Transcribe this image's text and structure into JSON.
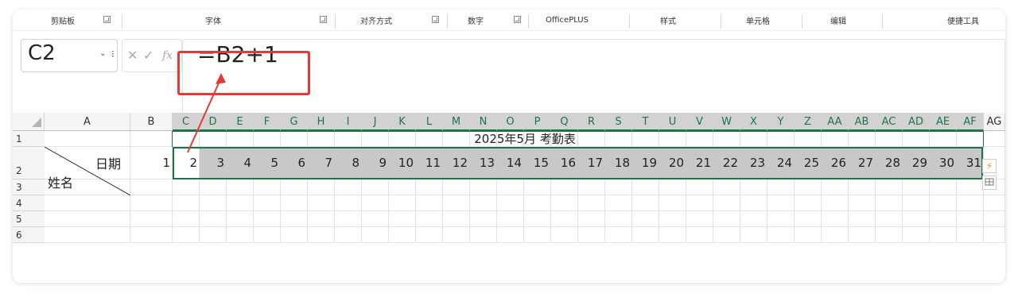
{
  "ribbon": {
    "groups": [
      "剪贴板",
      "字体",
      "对齐方式",
      "数字",
      "OfficePLUS",
      "样式",
      "单元格",
      "编辑",
      "便捷工具"
    ]
  },
  "formula_bar": {
    "name_box": "C2",
    "dropdown": "⌄",
    "dots": "⁝",
    "cancel": "✕",
    "confirm": "✓",
    "fx": "fx",
    "formula": "=B2+1"
  },
  "columns": [
    "A",
    "B",
    "C",
    "D",
    "E",
    "F",
    "G",
    "H",
    "I",
    "J",
    "K",
    "L",
    "M",
    "N",
    "O",
    "P",
    "Q",
    "R",
    "S",
    "T",
    "U",
    "V",
    "W",
    "X",
    "Y",
    "Z",
    "AA",
    "AB",
    "AC",
    "AD",
    "AE",
    "AF",
    "AG"
  ],
  "rows": [
    "1",
    "2",
    "3",
    "4",
    "5",
    "6"
  ],
  "sheet": {
    "title": "2025年5月 考勤表",
    "header_date": "日期",
    "header_name": "姓名",
    "days": [
      "1",
      "2",
      "3",
      "4",
      "5",
      "6",
      "7",
      "8",
      "9",
      "10",
      "11",
      "12",
      "13",
      "14",
      "15",
      "16",
      "17",
      "18",
      "19",
      "20",
      "21",
      "22",
      "23",
      "24",
      "25",
      "26",
      "27",
      "28",
      "29",
      "30",
      "31"
    ]
  },
  "colors": {
    "accent": "#217346",
    "highlight": "#e53935",
    "selected_fill": "#c8c8c8"
  }
}
